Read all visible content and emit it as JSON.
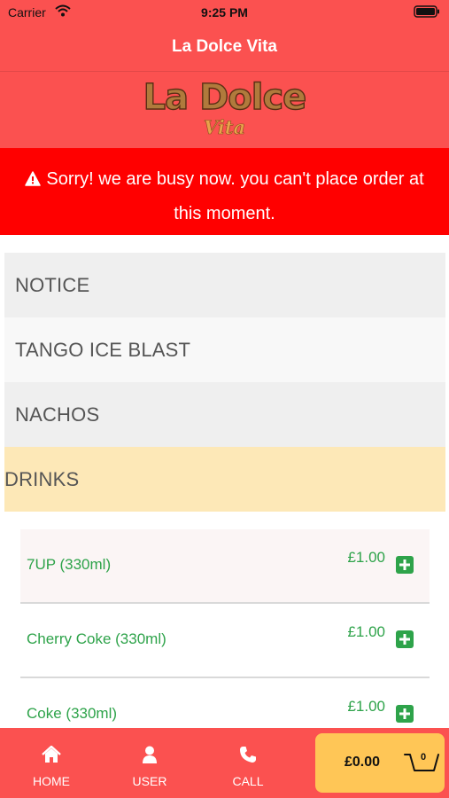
{
  "status_bar": {
    "carrier": "Carrier",
    "time": "9:25 PM"
  },
  "header": {
    "title": "La Dolce Vita"
  },
  "logo": {
    "main": "La Dolce",
    "sub": "Vita"
  },
  "alert": {
    "message": "Sorry! we are busy now. you can't place order at this moment."
  },
  "categories": [
    {
      "label": "NOTICE"
    },
    {
      "label": "TANGO ICE BLAST"
    },
    {
      "label": "NACHOS"
    },
    {
      "label": "DRINKS"
    }
  ],
  "items": [
    {
      "name": "7UP (330ml)",
      "price": "£1.00"
    },
    {
      "name": "Cherry Coke (330ml)",
      "price": "£1.00"
    },
    {
      "name": "Coke (330ml)",
      "price": "£1.00"
    }
  ],
  "tabs": {
    "home": "HOME",
    "user": "USER",
    "call": "CALL"
  },
  "cart": {
    "total": "£0.00",
    "count": "0"
  },
  "colors": {
    "primary": "#fb5150",
    "alert": "#ff0000",
    "accent": "#2ea34a",
    "cart": "#ffc656",
    "active_category": "#fde8b7"
  },
  "icons": [
    "wifi-icon",
    "battery-icon",
    "warning-icon",
    "plus-square-icon",
    "home-icon",
    "user-icon",
    "phone-icon",
    "basket-icon"
  ]
}
